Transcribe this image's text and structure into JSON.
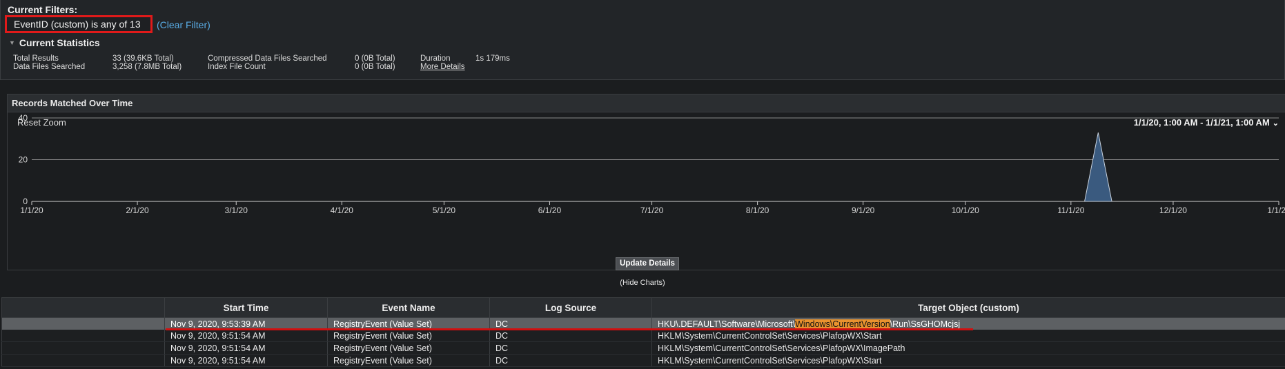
{
  "filters": {
    "title": "Current Filters:",
    "active_filter": "EventID (custom) is any of 13",
    "clear_label": "(Clear Filter)"
  },
  "statistics": {
    "title": "Current Statistics",
    "total_results_label": "Total Results",
    "total_results_value": "33 (39.6KB Total)",
    "data_files_label": "Data Files Searched",
    "data_files_value": "3,258 (7.8MB Total)",
    "compressed_label": "Compressed Data Files Searched",
    "compressed_value": "0 (0B Total)",
    "index_label": "Index File Count",
    "index_value": "0 (0B Total)",
    "duration_label": "Duration",
    "duration_value": "1s 179ms",
    "more_details": "More Details"
  },
  "chart_panel": {
    "title": "Records Matched Over Time",
    "reset_zoom": "Reset Zoom",
    "range": "1/1/20, 1:00 AM - 1/1/21, 1:00 AM",
    "update_details": "Update Details",
    "hide_charts": "(Hide Charts)"
  },
  "chart_data": {
    "type": "area",
    "title": "Records Matched Over Time",
    "x_ticks": [
      "1/1/20",
      "2/1/20",
      "3/1/20",
      "4/1/20",
      "5/1/20",
      "6/1/20",
      "7/1/20",
      "8/1/20",
      "9/1/20",
      "10/1/20",
      "11/1/20",
      "12/1/20",
      "1/1/21"
    ],
    "y_ticks": [
      "0",
      "20",
      "40"
    ],
    "ylim": [
      0,
      40
    ],
    "xlim": [
      "2020-01-01",
      "2021-01-01"
    ],
    "series": [
      {
        "color": "#3a5a7f",
        "points": [
          {
            "x": "2020-11-05",
            "y": 0
          },
          {
            "x": "2020-11-09",
            "y": 33
          },
          {
            "x": "2020-11-13",
            "y": 0
          }
        ]
      }
    ],
    "grid": true
  },
  "table": {
    "columns": [
      "",
      "Start Time",
      "Event Name",
      "Log Source",
      "Target Object (custom)"
    ],
    "rows": [
      {
        "start_time": "Nov 9, 2020, 9:53:39 AM",
        "event_name": "RegistryEvent (Value Set)",
        "log_source": "DC",
        "target_pre": "HKU\\.DEFAULT\\Software\\Microsoft\\",
        "target_hl": "Windows\\CurrentVersion",
        "target_post": "\\Run\\SsGHOMcjsj"
      },
      {
        "start_time": "Nov 9, 2020, 9:51:54 AM",
        "event_name": "RegistryEvent (Value Set)",
        "log_source": "DC",
        "target": "HKLM\\System\\CurrentControlSet\\Services\\PlafopWX\\Start"
      },
      {
        "start_time": "Nov 9, 2020, 9:51:54 AM",
        "event_name": "RegistryEvent (Value Set)",
        "log_source": "DC",
        "target": "HKLM\\System\\CurrentControlSet\\Services\\PlafopWX\\ImagePath"
      },
      {
        "start_time": "Nov 9, 2020, 9:51:54 AM",
        "event_name": "RegistryEvent (Value Set)",
        "log_source": "DC",
        "target": "HKLM\\System\\CurrentControlSet\\Services\\PlafopWX\\Start"
      }
    ]
  }
}
